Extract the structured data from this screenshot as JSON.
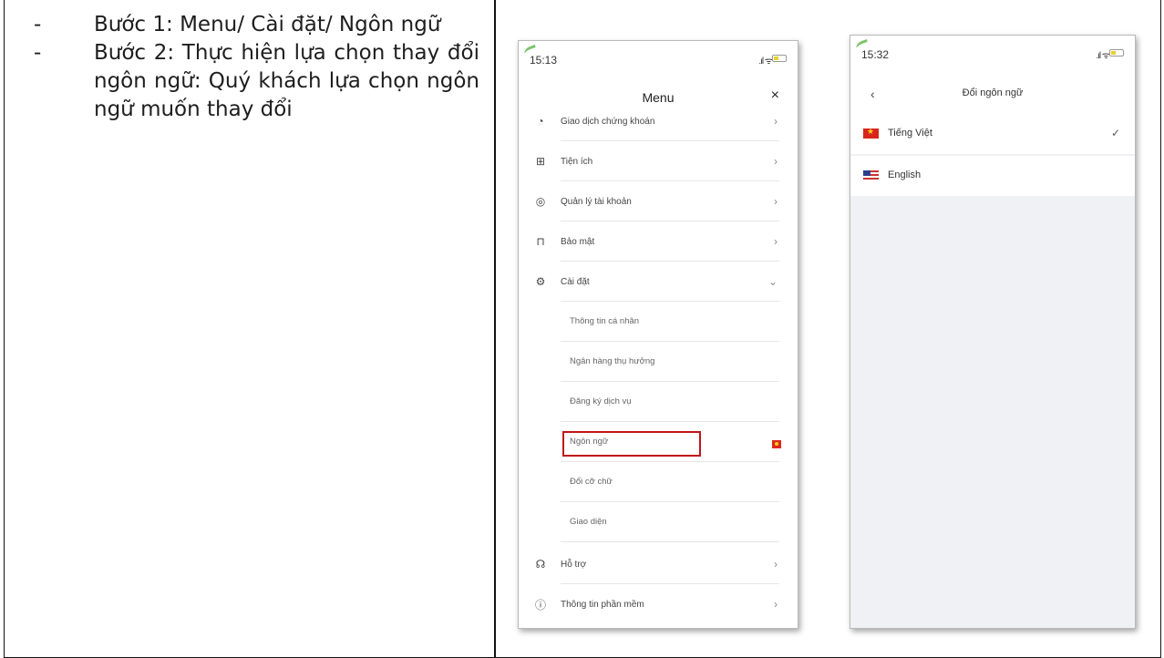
{
  "steps": [
    {
      "bullet": "-",
      "text": "Bước 1: Menu/ Cài đặt/ Ngôn ngữ"
    },
    {
      "bullet": "-",
      "text": "Bước 2: Thực hiện lựa chọn thay đổi ngôn ngữ: Quý khách lựa chọn ngôn ngữ muốn thay đổi"
    }
  ],
  "screen1": {
    "time": "15:13",
    "title": "Menu",
    "close": "×",
    "items": [
      {
        "label": "Giao dịch chứng khoán",
        "icon": "stock-icon",
        "glyph": "◔",
        "chevron": "›"
      },
      {
        "label": "Tiện ích",
        "icon": "utilities-icon",
        "glyph": "⊞",
        "chevron": "›"
      },
      {
        "label": "Quản lý tài khoản",
        "icon": "account-icon",
        "glyph": "◎",
        "chevron": "›"
      },
      {
        "label": "Bảo mật",
        "icon": "lock-icon",
        "glyph": "⊓",
        "chevron": "›"
      },
      {
        "label": "Cài đặt",
        "icon": "gear-icon",
        "glyph": "⚙",
        "chevron": "⌄"
      }
    ],
    "sub_items": [
      "Thông tin cá nhân",
      "Ngân hàng thụ hưởng",
      "Đăng ký dịch vụ",
      "Ngôn ngữ",
      "Đổi cỡ chữ",
      "Giao diện"
    ],
    "bottom_items": [
      {
        "label": "Hỗ trợ",
        "icon": "headset-icon",
        "glyph": "☊",
        "chevron": "›"
      },
      {
        "label": "Thông tin phần mềm",
        "icon": "info-icon",
        "glyph": "ⓘ",
        "chevron": "›"
      }
    ]
  },
  "screen2": {
    "time": "15:32",
    "back": "‹",
    "title": "Đổi ngôn ngữ",
    "languages": [
      {
        "label": "Tiếng Việt",
        "flag": "vietnam-flag-icon",
        "selected": true,
        "check": "✓"
      },
      {
        "label": "English",
        "flag": "us-flag-icon",
        "selected": false,
        "check": ""
      }
    ]
  },
  "colors": {
    "highlight": "#c0151a",
    "list_bg": "#f0f1f5"
  }
}
